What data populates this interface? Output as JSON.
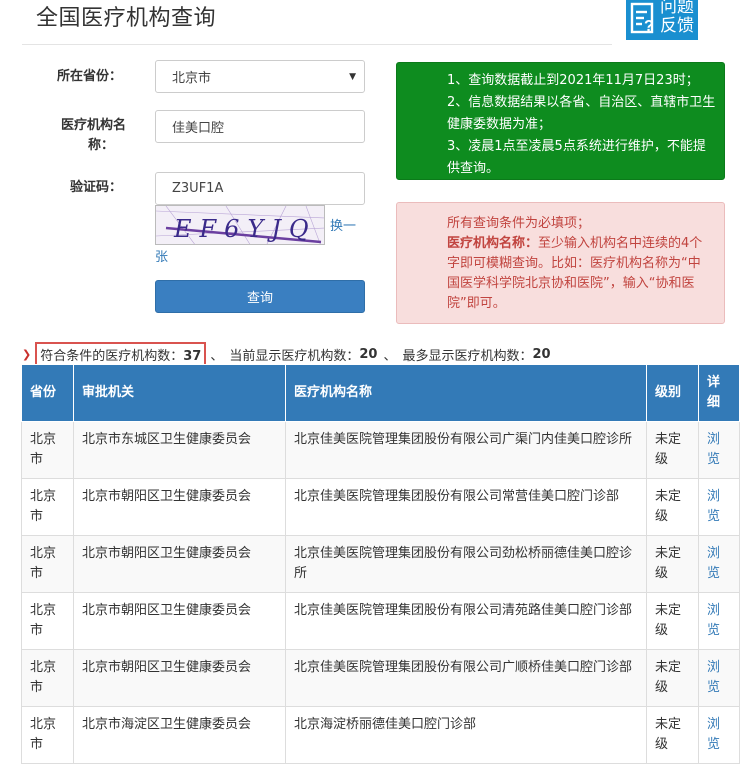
{
  "page": {
    "title": "全国医疗机构查询"
  },
  "feedback": {
    "line1": "问题",
    "line2": "反馈"
  },
  "form": {
    "province_label": "所在省份：",
    "province_value": "北京市",
    "name_label_line1": "医疗机构名",
    "name_label_line2": "称：",
    "name_value": "佳美口腔",
    "captcha_label": "验证码：",
    "captcha_value": "Z3UF1A",
    "captcha_image_text": "EF6YJQ",
    "refresh_line1": "换一",
    "refresh_line2": "张",
    "query_button": "查询"
  },
  "notice_green": {
    "line1": "1、查询数据截止到2021年11月7日23时；",
    "line2": "2、信息数据结果以各省、自治区、直辖市卫生健康委数据为准；",
    "line3": "3、凌晨1点至凌晨5点系统进行维护，不能提供查询。"
  },
  "notice_red": {
    "line1": "所有查询条件为必填项；",
    "line2_label": "医疗机构名称：",
    "line2_text": "至少输入机构名中连续的4个字即可模糊查询。比如：医疗机构名称为“中国医学科学院北京协和医院”，输入“协和医院”即可。"
  },
  "summary": {
    "match_label": "符合条件的医疗机构数：",
    "match_count": "37",
    "sep1": "、",
    "shown_label": "当前显示医疗机构数：",
    "shown_count": "20",
    "sep2": "、",
    "max_label": "最多显示医疗机构数：",
    "max_count": "20"
  },
  "table": {
    "headers": [
      "省份",
      "审批机关",
      "医疗机构名称",
      "级别",
      "详细"
    ],
    "rows": [
      [
        "北京市",
        "北京市东城区卫生健康委员会",
        "北京佳美医院管理集团股份有限公司广渠门内佳美口腔诊所",
        "未定级",
        "浏览"
      ],
      [
        "北京市",
        "北京市朝阳区卫生健康委员会",
        "北京佳美医院管理集团股份有限公司常营佳美口腔门诊部",
        "未定级",
        "浏览"
      ],
      [
        "北京市",
        "北京市朝阳区卫生健康委员会",
        "北京佳美医院管理集团股份有限公司劲松桥丽德佳美口腔诊所",
        "未定级",
        "浏览"
      ],
      [
        "北京市",
        "北京市朝阳区卫生健康委员会",
        "北京佳美医院管理集团股份有限公司清苑路佳美口腔门诊部",
        "未定级",
        "浏览"
      ],
      [
        "北京市",
        "北京市朝阳区卫生健康委员会",
        "北京佳美医院管理集团股份有限公司广顺桥佳美口腔门诊部",
        "未定级",
        "浏览"
      ],
      [
        "北京市",
        "北京市海淀区卫生健康委员会",
        "北京海淀桥丽德佳美口腔门诊部",
        "未定级",
        "浏览"
      ]
    ]
  },
  "colors": {
    "primary": "#337ab7",
    "notice_green": "#0e8c1f",
    "notice_red_bg": "#f8dedd",
    "notice_red_text": "#c1443f",
    "feedback_bg": "#1a8fd0"
  },
  "icons": {
    "feedback": "feedback-icon",
    "dropdown": "chevron-down-icon",
    "summary_marker": "double-chevron-right-icon"
  }
}
